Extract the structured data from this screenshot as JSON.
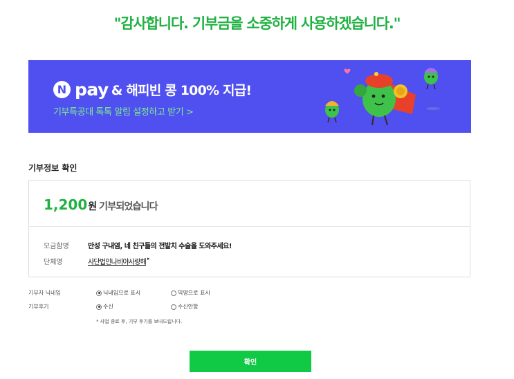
{
  "header": {
    "thanks": "\"감사합니다. 기부금을 소중하게 사용하겠습니다.\""
  },
  "banner": {
    "n_logo": "N",
    "pay_word": "pay",
    "promo": "& 해피빈 콩 100% 지급!",
    "subline": "기부특공대 톡톡 알림 설정하고 받기 >"
  },
  "donation": {
    "section_title": "기부정보 확인",
    "amount": "1,200",
    "amount_unit": "원",
    "amount_suffix": "기부되었습니다",
    "fundraising_label": "모금함명",
    "fundraising_value": "만성 구내염, 네 친구들의 전발치 수술을 도와주세요!",
    "org_label": "단체명",
    "org_value": "사단법인나비야사랑해",
    "org_arrow": "▸"
  },
  "options": {
    "nickname_label": "기부자 닉네임",
    "nickname_opt1": "닉네임으로 표시",
    "nickname_opt2": "익명으로 표시",
    "review_label": "기부후기",
    "review_opt1": "수신",
    "review_opt2": "수신안함",
    "note": "* 사업 종료 후, 기부 후기를 보내드립니다."
  },
  "buttons": {
    "confirm": "확인"
  },
  "colors": {
    "accent": "#1fb141",
    "banner_bg": "#5050f0",
    "button": "#10c945"
  }
}
